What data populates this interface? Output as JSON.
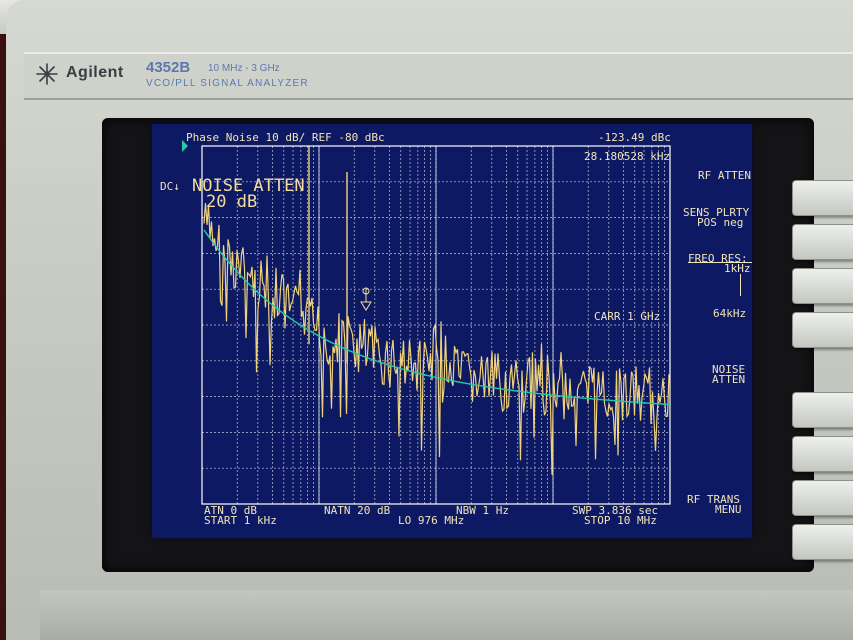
{
  "instrument": {
    "brand": "Agilent",
    "model": "4352B",
    "freq_range": "10 MHz - 3 GHz",
    "subtitle": "VCO/PLL SIGNAL ANALYZER"
  },
  "screen": {
    "header_left": "Phase Noise  10 dB/ REF -80 dBc",
    "marker_value": "-123.49 dBc",
    "marker_freq": "28.180528 kHz",
    "dc_indicator": "DC↓",
    "overlay_line1": "NOISE ATTEN",
    "overlay_line2": "20 dB",
    "carrier": "CARR  1 GHz",
    "footer": {
      "atn": "ATN  0 dB",
      "start": "START  1 kHz",
      "natn": "NATN 20 dB",
      "lo": "LO  976 MHz",
      "nbw": "NBW  1 Hz",
      "swp": "SWP  3.836 sec",
      "stop": "STOP  10 MHz"
    }
  },
  "softkeys": {
    "rf_atten": "RF ATTEN",
    "sens_plrty_1": "SENS PLRTY",
    "sens_plrty_2": "POS  neg",
    "freq_res_1": "FREQ RES:",
    "freq_res_2": "1kHz",
    "freq_res_3": "64kHz",
    "noise_atten_1": "NOISE",
    "noise_atten_2": "ATTEN",
    "rf_trans_1": "RF TRANS",
    "rf_trans_2": "MENU"
  },
  "colors": {
    "screen_bg": "#0d1a63",
    "trace_raw": "#f0d27a",
    "trace_avg": "#27c9a8",
    "grid": "#ffffff",
    "text": "#f1e4b8"
  }
}
